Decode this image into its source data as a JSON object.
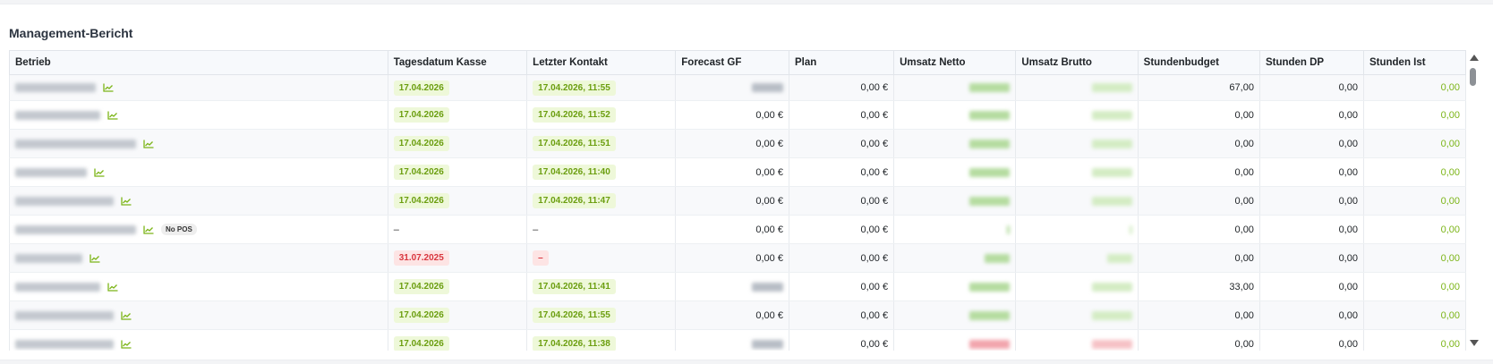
{
  "report": {
    "title": "Management-Bericht"
  },
  "table": {
    "columns": {
      "betrieb": "Betrieb",
      "tagesdatum": "Tagesdatum Kasse",
      "kontakt": "Letzter Kontakt",
      "forecast": "Forecast GF",
      "plan": "Plan",
      "netto": "Umsatz Netto",
      "brutto": "Umsatz Brutto",
      "budget": "Stundenbudget",
      "dp": "Stunden DP",
      "ist": "Stunden Ist"
    },
    "rows": [
      {
        "tagesdatum": "17.04.2026",
        "tagesdatum_status": "ok",
        "kontakt": "17.04.2026, 11:55",
        "kontakt_status": "ok",
        "forecast": "",
        "plan": "0,00 €",
        "budget": "67,00",
        "dp": "0,00",
        "ist": "0,00",
        "no_pos": false
      },
      {
        "tagesdatum": "17.04.2026",
        "tagesdatum_status": "ok",
        "kontakt": "17.04.2026, 11:52",
        "kontakt_status": "ok",
        "forecast": "0,00 €",
        "plan": "0,00 €",
        "budget": "0,00",
        "dp": "0,00",
        "ist": "0,00",
        "no_pos": false
      },
      {
        "tagesdatum": "17.04.2026",
        "tagesdatum_status": "ok",
        "kontakt": "17.04.2026, 11:51",
        "kontakt_status": "ok",
        "forecast": "0,00 €",
        "plan": "0,00 €",
        "budget": "0,00",
        "dp": "0,00",
        "ist": "0,00",
        "no_pos": false
      },
      {
        "tagesdatum": "17.04.2026",
        "tagesdatum_status": "ok",
        "kontakt": "17.04.2026, 11:40",
        "kontakt_status": "ok",
        "forecast": "0,00 €",
        "plan": "0,00 €",
        "budget": "0,00",
        "dp": "0,00",
        "ist": "0,00",
        "no_pos": false
      },
      {
        "tagesdatum": "17.04.2026",
        "tagesdatum_status": "ok",
        "kontakt": "17.04.2026, 11:47",
        "kontakt_status": "ok",
        "forecast": "0,00 €",
        "plan": "0,00 €",
        "budget": "0,00",
        "dp": "0,00",
        "ist": "0,00",
        "no_pos": false
      },
      {
        "tagesdatum": "–",
        "tagesdatum_status": "none",
        "kontakt": "–",
        "kontakt_status": "none",
        "forecast": "0,00 €",
        "plan": "0,00 €",
        "budget": "0,00",
        "dp": "0,00",
        "ist": "0,00",
        "no_pos": true
      },
      {
        "tagesdatum": "31.07.2025",
        "tagesdatum_status": "bad",
        "kontakt": "–",
        "kontakt_status": "bad",
        "forecast": "0,00 €",
        "plan": "0,00 €",
        "budget": "0,00",
        "dp": "0,00",
        "ist": "0,00",
        "no_pos": false
      },
      {
        "tagesdatum": "17.04.2026",
        "tagesdatum_status": "ok",
        "kontakt": "17.04.2026, 11:41",
        "kontakt_status": "ok",
        "forecast": "",
        "plan": "0,00 €",
        "budget": "33,00",
        "dp": "0,00",
        "ist": "0,00",
        "no_pos": false
      },
      {
        "tagesdatum": "17.04.2026",
        "tagesdatum_status": "ok",
        "kontakt": "17.04.2026, 11:55",
        "kontakt_status": "ok",
        "forecast": "0,00 €",
        "plan": "0,00 €",
        "budget": "0,00",
        "dp": "0,00",
        "ist": "0,00",
        "no_pos": false
      },
      {
        "tagesdatum": "17.04.2026",
        "tagesdatum_status": "ok",
        "kontakt": "17.04.2026, 11:38",
        "kontakt_status": "ok",
        "forecast": "",
        "plan": "0,00 €",
        "budget": "0,00",
        "dp": "0,00",
        "ist": "0,00",
        "no_pos": false
      }
    ],
    "badge_text": {
      "no_pos": "No POS"
    }
  },
  "colors": {
    "ok_bg": "#eef8d9",
    "ok_text": "#6b9e0f",
    "bad_bg": "#fde4e4",
    "bad_text": "#d9363e",
    "ist_text": "#7cb518",
    "chart_icon": "#7cb518"
  },
  "icons": {
    "trend": "chart-line-icon",
    "scroll_up": "arrow-up-icon",
    "scroll_down": "arrow-down-icon"
  }
}
